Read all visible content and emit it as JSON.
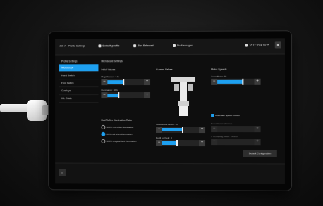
{
  "topbar": {
    "app": "NKS X - Profile Settings",
    "profile": "Default profile",
    "slot": "Slot Selected",
    "messages": "No Messages",
    "datetime": "16.12.2024 19:25"
  },
  "sidebar": {
    "title": "Profile Settings",
    "items": [
      {
        "label": "Microscope"
      },
      {
        "label": "Hand Switch"
      },
      {
        "label": "Foot Switch"
      },
      {
        "label": "Overlays"
      },
      {
        "label": "ICL Guide"
      }
    ]
  },
  "main": {
    "title": "Microscope Settings",
    "initial_title": "Initial Values",
    "current_title": "Current Values",
    "motor_title": "Motor Speeds",
    "magnification_label": "Magnification: 4.7x",
    "magnification_value": 0.45,
    "illumination_label": "Illumination: 30%",
    "illumination_value": 0.3,
    "zoom_label": "Zoom Motor: 70",
    "zoom_value": 0.7,
    "auto_speed_label": "Automatic Speed Control",
    "focus_label": "Focus Motor: 24mm/s",
    "xy_label": "XY Coupling Motor: 24mm/s",
    "red_reflex_title": "Red Reflex Illumination Ratio",
    "radio_options": [
      "100% red reflex illumination",
      "60% red reflex illumination",
      "100% surgical field illumination"
    ],
    "glasses_label": "Glassome Position: 12°",
    "glasses_value": 0.55,
    "depth_label": "Depth of Field: 3",
    "depth_value": 0.4,
    "default_button": "Default Configuration"
  },
  "bottom": {
    "home_icon": "home-icon"
  }
}
